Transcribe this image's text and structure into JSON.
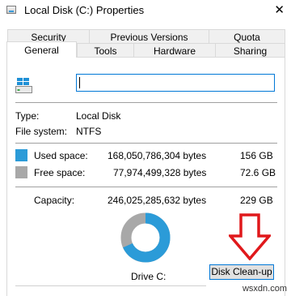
{
  "window": {
    "title": "Local Disk (C:) Properties",
    "close_glyph": "✕"
  },
  "tabs": {
    "row1": [
      "Security",
      "Previous Versions",
      "Quota"
    ],
    "row2": [
      "General",
      "Tools",
      "Hardware",
      "Sharing"
    ],
    "active": "General"
  },
  "general": {
    "drive_name_value": "",
    "type_label": "Type:",
    "type_value": "Local Disk",
    "fs_label": "File system:",
    "fs_value": "NTFS",
    "used_label": "Used space:",
    "used_bytes": "168,050,786,304 bytes",
    "used_size": "156 GB",
    "free_label": "Free space:",
    "free_bytes": "77,974,499,328 bytes",
    "free_size": "72.6 GB",
    "capacity_label": "Capacity:",
    "capacity_bytes": "246,025,285,632 bytes",
    "capacity_size": "229 GB",
    "drive_label": "Drive C:",
    "cleanup_button": "Disk Clean-up"
  },
  "colors": {
    "used": "#2b9bd8",
    "free": "#a8a8a8",
    "arrow": "#e0181b",
    "focus": "#0078d7"
  },
  "usage": {
    "used_bytes": 168050786304,
    "free_bytes": 77974499328
  },
  "icons": [
    "drive-icon",
    "window-icon",
    "close-icon",
    "red-arrow-annotation"
  ],
  "watermark": "wsxdn.com"
}
